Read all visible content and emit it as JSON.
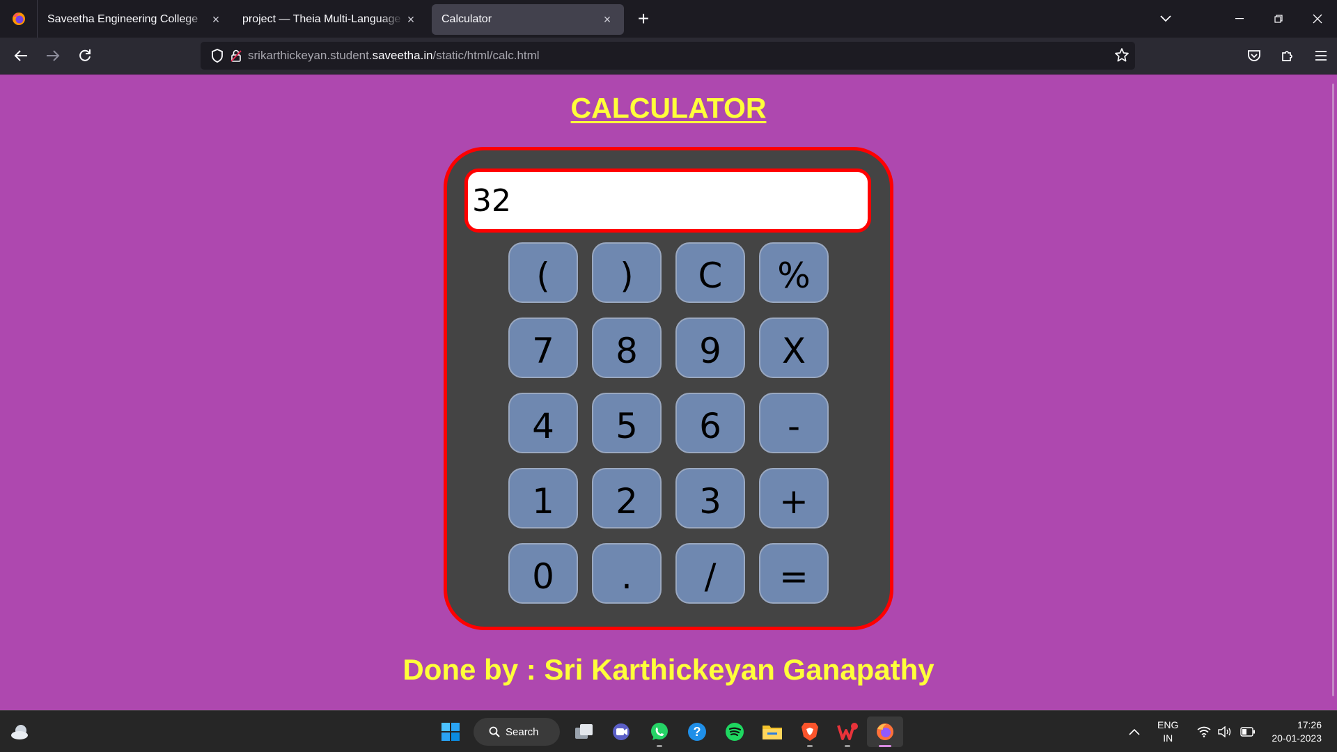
{
  "browser": {
    "tabs": [
      {
        "label": "Saveetha Engineering College",
        "active": false
      },
      {
        "label": "project — Theia Multi-Language Exp",
        "active": false
      },
      {
        "label": "Calculator",
        "active": true
      }
    ],
    "url_prefix": "srikarthickeyan.student.",
    "url_host": "saveetha.in",
    "url_path": "/static/html/calc.html"
  },
  "page": {
    "title": "CALCULATOR",
    "display_value": "32",
    "keys": [
      "(",
      ")",
      "C",
      "%",
      "7",
      "8",
      "9",
      "X",
      "4",
      "5",
      "6",
      "-",
      "1",
      "2",
      "3",
      "+",
      "0",
      ".",
      "/",
      "="
    ],
    "footer": "Done by : Sri Karthickeyan Ganapathy",
    "colors": {
      "background": "#ae48af",
      "accent_text": "#ffff3a",
      "calc_body": "#444444",
      "border": "#ff0000",
      "key": "#6f88b0"
    }
  },
  "taskbar": {
    "search_label": "Search",
    "apps": [
      "windows-start-icon",
      "task-view-icon",
      "teams-meet-icon",
      "whatsapp-icon",
      "help-icon",
      "spotify-icon",
      "file-explorer-icon",
      "brave-icon",
      "wps-office-icon",
      "firefox-icon"
    ],
    "lang_top": "ENG",
    "lang_bottom": "IN",
    "time": "17:26",
    "date": "20-01-2023"
  }
}
